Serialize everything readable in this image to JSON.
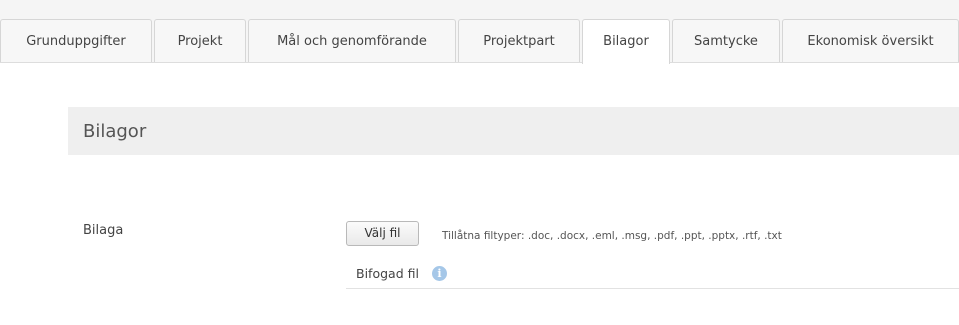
{
  "tabs": [
    {
      "label": "Grunduppgifter",
      "active": false
    },
    {
      "label": "Projekt",
      "active": false
    },
    {
      "label": "Mål och genomförande",
      "active": false
    },
    {
      "label": "Projektpart",
      "active": false
    },
    {
      "label": "Bilagor",
      "active": true
    },
    {
      "label": "Samtycke",
      "active": false
    },
    {
      "label": "Ekonomisk översikt",
      "active": false
    }
  ],
  "section": {
    "title": "Bilagor"
  },
  "attachment": {
    "label": "Bilaga",
    "choose_file_label": "Välj fil",
    "allowed_types": "Tillåtna filtyper: .doc, .docx, .eml, .msg, .pdf, .ppt, .pptx, .rtf, .txt",
    "attached_label": "Bifogad fil",
    "info_icon": "info-icon"
  },
  "colors": {
    "tabbar_background": "#f5f5f5",
    "section_background": "#efefef",
    "info_icon": "#a5c7e8"
  }
}
